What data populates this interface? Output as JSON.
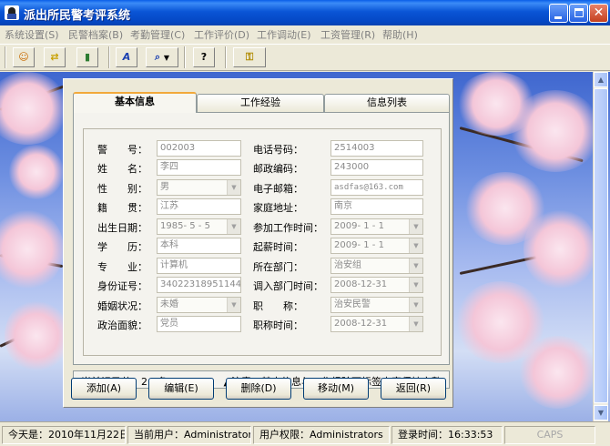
{
  "window": {
    "title": "派出所民警考评系统"
  },
  "menu": [
    {
      "label": "系统设置(S)"
    },
    {
      "label": "民警档案(B)"
    },
    {
      "label": "考勤管理(C)"
    },
    {
      "label": "工作评价(D)"
    },
    {
      "label": "工作调动(E)"
    },
    {
      "label": "工资管理(R)"
    },
    {
      "label": "帮助(H)"
    }
  ],
  "toolbar": {
    "icons": [
      "user-icon",
      "arrows-icon",
      "exit-door-icon",
      "font-icon",
      "search-icon",
      "help-icon",
      "key-icon"
    ]
  },
  "tabs": [
    {
      "label": "基本信息",
      "active": true
    },
    {
      "label": "工作经验"
    },
    {
      "label": "信息列表"
    }
  ],
  "form": {
    "left": [
      {
        "label": "警　　号：",
        "value": "002003",
        "type": "text"
      },
      {
        "label": "姓　　名：",
        "value": "李四",
        "type": "text"
      },
      {
        "label": "性　　别：",
        "value": "男",
        "type": "combo"
      },
      {
        "label": "籍　　贯：",
        "value": "江苏",
        "type": "text"
      },
      {
        "label": "出生日期：",
        "value": "1985- 5 - 5",
        "type": "combo"
      },
      {
        "label": "学　　历：",
        "value": "本科",
        "type": "text"
      },
      {
        "label": "专　　业：",
        "value": "计算机",
        "type": "text"
      },
      {
        "label": "身份证号：",
        "value": "340223189511444",
        "type": "text"
      },
      {
        "label": "婚姻状况：",
        "value": "未婚",
        "type": "combo"
      },
      {
        "label": "政治面貌：",
        "value": "党员",
        "type": "text"
      }
    ],
    "right": [
      {
        "label": "电话号码：",
        "value": "2514003",
        "type": "text"
      },
      {
        "label": "邮政编码：",
        "value": "243000",
        "type": "text"
      },
      {
        "label": "电子邮箱：",
        "value": "asdfas@163.com",
        "type": "text"
      },
      {
        "label": "家庭地址：",
        "value": "南京",
        "type": "text"
      },
      {
        "label": "参加工作时间：",
        "value": "2009- 1 - 1",
        "type": "combo"
      },
      {
        "label": "起薪时间：",
        "value": "2009- 1 - 1",
        "type": "combo"
      },
      {
        "label": "所在部门：",
        "value": "治安组",
        "type": "combo"
      },
      {
        "label": "调入部门时间：",
        "value": "2008-12-31",
        "type": "combo"
      },
      {
        "label": "职　　称：",
        "value": "治安民警",
        "type": "combo"
      },
      {
        "label": "职称时间：",
        "value": "2008-12-31",
        "type": "combo"
      }
    ]
  },
  "record_status": "当前记录共　2　条",
  "notice": "▲注意：基本信息与工作经验两标签内容保持完整",
  "buttons": [
    {
      "label": "添加(A)"
    },
    {
      "label": "编辑(E)"
    },
    {
      "label": "删除(D)"
    },
    {
      "label": "移动(M)"
    },
    {
      "label": "返回(R)"
    }
  ],
  "statusbar": {
    "today": "今天是：2010年11月22日",
    "user": "当前用户：Administrator",
    "role": "用户权限：Administrators",
    "login_time": "登录时间：16:33:53",
    "caps": "CAPS"
  },
  "colors": {
    "titlebar": "#0a55d6",
    "accent_tab": "#f2a93b",
    "face": "#ece9d8"
  }
}
